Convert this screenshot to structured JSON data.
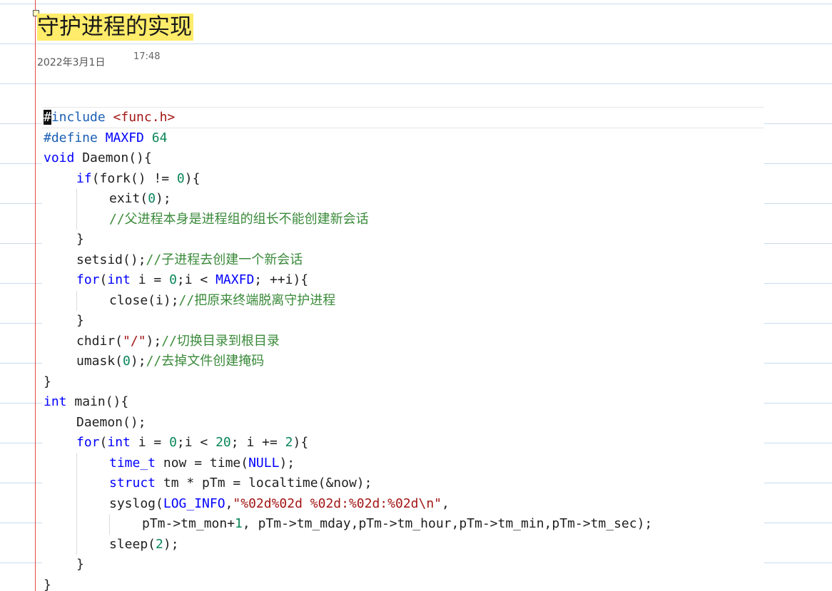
{
  "note": {
    "title": "守护进程的实现",
    "date": "2022年3月1日",
    "time": "17:48"
  },
  "code": {
    "language": "c",
    "lines": [
      {
        "indent": 0,
        "tokens": [
          {
            "t": "cursor",
            "v": "#"
          },
          {
            "t": "pp",
            "v": "include "
          },
          {
            "t": "str",
            "v": "<func.h>"
          }
        ]
      },
      {
        "indent": 0,
        "tokens": [
          {
            "t": "pp",
            "v": "#define "
          },
          {
            "t": "mac",
            "v": "MAXFD "
          },
          {
            "t": "num",
            "v": "64"
          }
        ]
      },
      {
        "indent": 0,
        "tokens": [
          {
            "t": "kw",
            "v": "void"
          },
          {
            "t": "plain",
            "v": " Daemon(){"
          }
        ]
      },
      {
        "indent": 1,
        "tokens": [
          {
            "t": "kw",
            "v": "if"
          },
          {
            "t": "plain",
            "v": "(fork() != "
          },
          {
            "t": "num",
            "v": "0"
          },
          {
            "t": "plain",
            "v": "){"
          }
        ]
      },
      {
        "indent": 2,
        "tokens": [
          {
            "t": "plain",
            "v": "exit("
          },
          {
            "t": "num",
            "v": "0"
          },
          {
            "t": "plain",
            "v": ");"
          }
        ]
      },
      {
        "indent": 2,
        "tokens": [
          {
            "t": "cm",
            "v": "//父进程本身是进程组的组长不能创建新会话"
          }
        ]
      },
      {
        "indent": 1,
        "tokens": [
          {
            "t": "plain",
            "v": "}"
          }
        ]
      },
      {
        "indent": 1,
        "tokens": [
          {
            "t": "plain",
            "v": "setsid();"
          },
          {
            "t": "cm",
            "v": "//子进程去创建一个新会话"
          }
        ]
      },
      {
        "indent": 1,
        "tokens": [
          {
            "t": "kw",
            "v": "for"
          },
          {
            "t": "plain",
            "v": "("
          },
          {
            "t": "kw",
            "v": "int"
          },
          {
            "t": "plain",
            "v": " i = "
          },
          {
            "t": "num",
            "v": "0"
          },
          {
            "t": "plain",
            "v": ";i < "
          },
          {
            "t": "mac",
            "v": "MAXFD"
          },
          {
            "t": "plain",
            "v": "; ++i){"
          }
        ]
      },
      {
        "indent": 2,
        "tokens": [
          {
            "t": "plain",
            "v": "close(i);"
          },
          {
            "t": "cm",
            "v": "//把原来终端脱离守护进程"
          }
        ]
      },
      {
        "indent": 1,
        "tokens": [
          {
            "t": "plain",
            "v": "}"
          }
        ]
      },
      {
        "indent": 1,
        "tokens": [
          {
            "t": "plain",
            "v": "chdir("
          },
          {
            "t": "str",
            "v": "\"/\""
          },
          {
            "t": "plain",
            "v": ");"
          },
          {
            "t": "cm",
            "v": "//切换目录到根目录"
          }
        ]
      },
      {
        "indent": 1,
        "tokens": [
          {
            "t": "plain",
            "v": "umask("
          },
          {
            "t": "num",
            "v": "0"
          },
          {
            "t": "plain",
            "v": ");"
          },
          {
            "t": "cm",
            "v": "//去掉文件创建掩码"
          }
        ]
      },
      {
        "indent": 0,
        "tokens": [
          {
            "t": "plain",
            "v": "}"
          }
        ]
      },
      {
        "indent": 0,
        "tokens": [
          {
            "t": "kw",
            "v": "int"
          },
          {
            "t": "plain",
            "v": " main(){"
          }
        ]
      },
      {
        "indent": 1,
        "tokens": [
          {
            "t": "plain",
            "v": "Daemon();"
          }
        ]
      },
      {
        "indent": 1,
        "tokens": [
          {
            "t": "kw",
            "v": "for"
          },
          {
            "t": "plain",
            "v": "("
          },
          {
            "t": "kw",
            "v": "int"
          },
          {
            "t": "plain",
            "v": " i = "
          },
          {
            "t": "num",
            "v": "0"
          },
          {
            "t": "plain",
            "v": ";i < "
          },
          {
            "t": "num",
            "v": "20"
          },
          {
            "t": "plain",
            "v": "; i += "
          },
          {
            "t": "num",
            "v": "2"
          },
          {
            "t": "plain",
            "v": "){"
          }
        ]
      },
      {
        "indent": 2,
        "tokens": [
          {
            "t": "kw",
            "v": "time_t"
          },
          {
            "t": "plain",
            "v": " now = time("
          },
          {
            "t": "mac",
            "v": "NULL"
          },
          {
            "t": "plain",
            "v": ");"
          }
        ]
      },
      {
        "indent": 2,
        "tokens": [
          {
            "t": "kw",
            "v": "struct"
          },
          {
            "t": "plain",
            "v": " tm * pTm = localtime(&now);"
          }
        ]
      },
      {
        "indent": 2,
        "tokens": [
          {
            "t": "plain",
            "v": "syslog("
          },
          {
            "t": "mac",
            "v": "LOG_INFO"
          },
          {
            "t": "plain",
            "v": ","
          },
          {
            "t": "str",
            "v": "\"%02d%02d %02d:%02d:%02d\\n\""
          },
          {
            "t": "plain",
            "v": ","
          }
        ]
      },
      {
        "indent": 3,
        "tokens": [
          {
            "t": "plain",
            "v": "pTm->tm_mon+"
          },
          {
            "t": "num",
            "v": "1"
          },
          {
            "t": "plain",
            "v": ", pTm->tm_mday,pTm->tm_hour,pTm->tm_min,pTm->tm_sec);"
          }
        ]
      },
      {
        "indent": 2,
        "tokens": [
          {
            "t": "plain",
            "v": "sleep("
          },
          {
            "t": "num",
            "v": "2"
          },
          {
            "t": "plain",
            "v": ");"
          }
        ]
      },
      {
        "indent": 1,
        "tokens": [
          {
            "t": "plain",
            "v": "}"
          }
        ]
      },
      {
        "indent": 0,
        "tokens": [
          {
            "t": "plain",
            "v": "}"
          }
        ]
      }
    ]
  }
}
